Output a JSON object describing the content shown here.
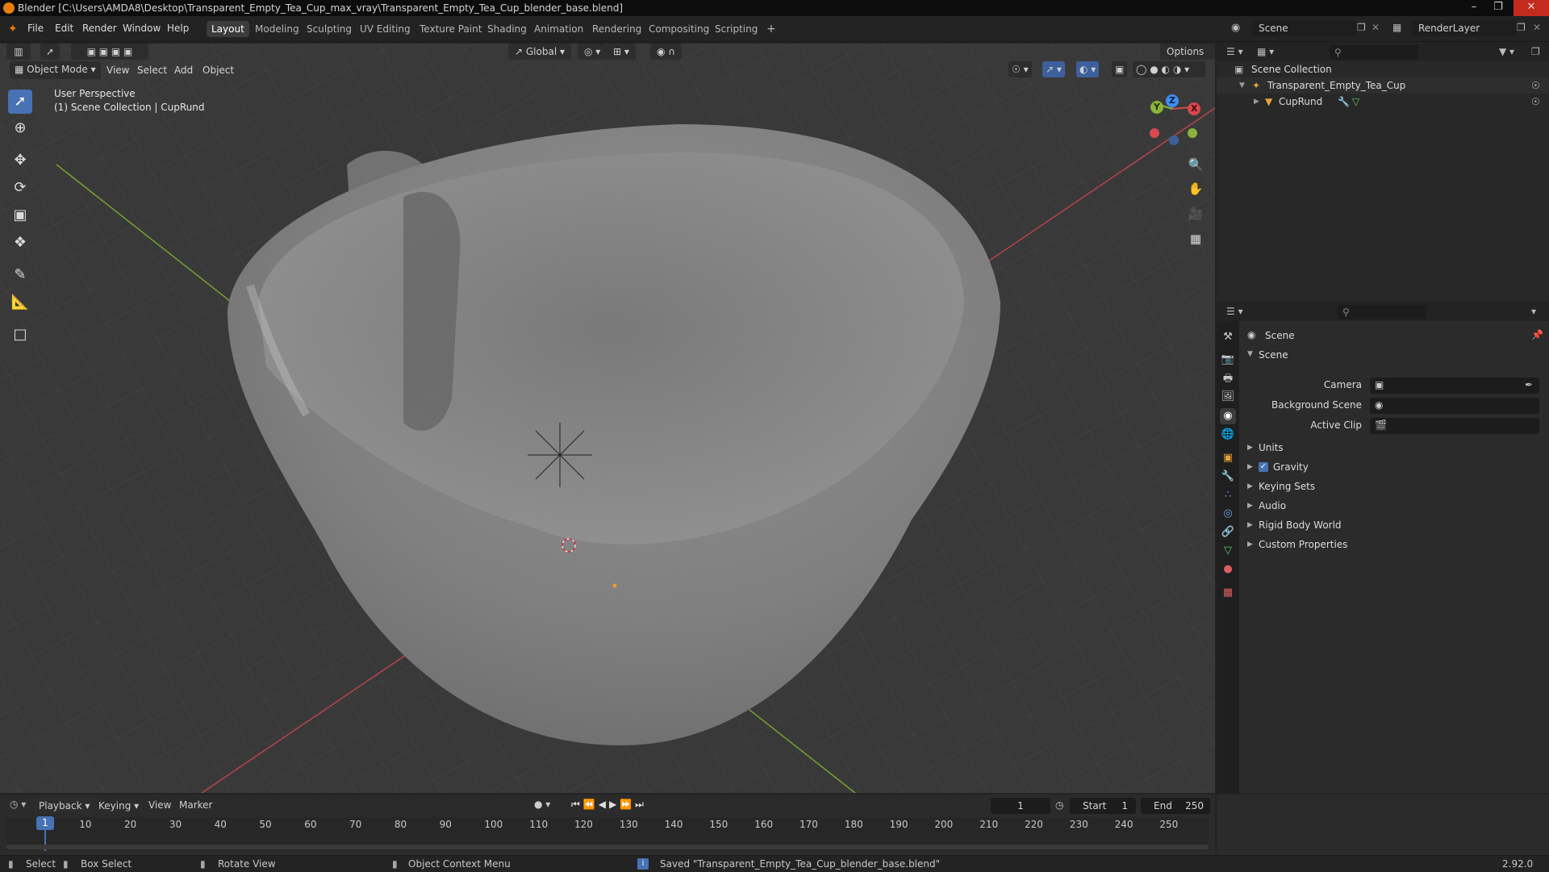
{
  "window": {
    "title": "Blender [C:\\Users\\AMDA8\\Desktop\\Transparent_Empty_Tea_Cup_max_vray\\Transparent_Empty_Tea_Cup_blender_base.blend]"
  },
  "menus": [
    "File",
    "Edit",
    "Render",
    "Window",
    "Help"
  ],
  "workspaces": [
    "Layout",
    "Modeling",
    "Sculpting",
    "UV Editing",
    "Texture Paint",
    "Shading",
    "Animation",
    "Rendering",
    "Compositing",
    "Scripting"
  ],
  "topbar": {
    "scene": "Scene",
    "render_layer": "RenderLayer",
    "add_tab": "+"
  },
  "viewport": {
    "mode": "Object Mode",
    "menus": [
      "View",
      "Select",
      "Add",
      "Object"
    ],
    "transform_orientation": "Global",
    "options": "Options",
    "info_line1": "User Perspective",
    "info_line2": "(1) Scene Collection | CupRund",
    "gizmo_axes": {
      "x": "X",
      "y": "Y",
      "z": "Z"
    }
  },
  "outliner": {
    "root": "Scene Collection",
    "items": [
      {
        "label": "Transparent_Empty_Tea_Cup"
      },
      {
        "label": "CupRund"
      }
    ]
  },
  "properties": {
    "context": "Scene",
    "panel": "Scene",
    "fields": [
      {
        "label": "Camera"
      },
      {
        "label": "Background Scene"
      },
      {
        "label": "Active Clip"
      }
    ],
    "subpanels": [
      "Units",
      "Gravity",
      "Keying Sets",
      "Audio",
      "Rigid Body World",
      "Custom Properties"
    ],
    "gravity_checked": true
  },
  "timeline": {
    "menus": [
      "Playback",
      "Keying",
      "View",
      "Marker"
    ],
    "current_frame": "1",
    "start_label": "Start",
    "start": "1",
    "end_label": "End",
    "end": "250",
    "ticks": [
      "1",
      "10",
      "20",
      "30",
      "40",
      "50",
      "60",
      "70",
      "80",
      "90",
      "100",
      "110",
      "120",
      "130",
      "140",
      "150",
      "160",
      "170",
      "180",
      "190",
      "200",
      "210",
      "220",
      "230",
      "240",
      "250"
    ]
  },
  "statusbar": {
    "select": "Select",
    "box_select": "Box Select",
    "rotate_view": "Rotate View",
    "context_menu": "Object Context Menu",
    "message": "Saved \"Transparent_Empty_Tea_Cup_blender_base.blend\"",
    "version": "2.92.0"
  },
  "colors": {
    "accent": "#4772b3",
    "x_axis": "#d9484f",
    "y_axis": "#8ab33a",
    "z_axis": "#3d8ef0",
    "blender_orange": "#e87d0d"
  }
}
